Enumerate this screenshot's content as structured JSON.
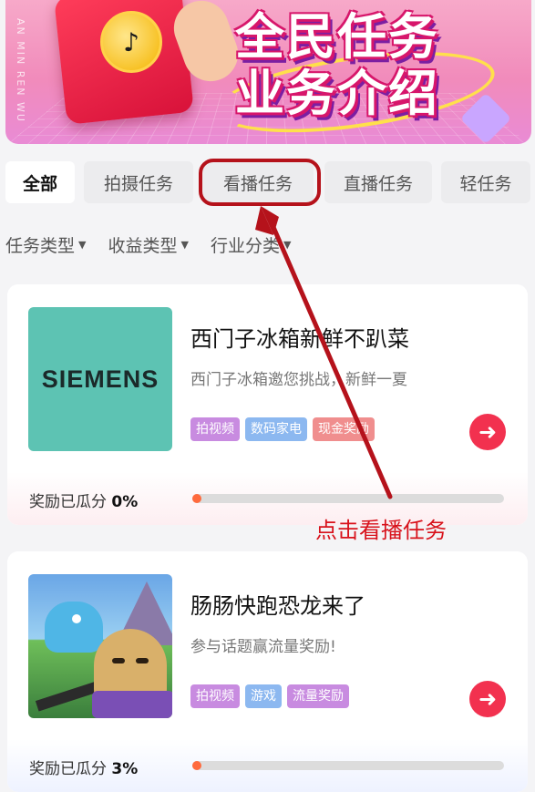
{
  "banner": {
    "title_line1": "全民任务",
    "title_line2": "业务介绍",
    "side_text": "AN MIN REN WU"
  },
  "tabs": [
    {
      "label": "全部",
      "active": true
    },
    {
      "label": "拍摄任务",
      "active": false
    },
    {
      "label": "看播任务",
      "active": false
    },
    {
      "label": "直播任务",
      "active": false
    },
    {
      "label": "轻任务",
      "active": false
    }
  ],
  "filters": [
    {
      "label": "任务类型"
    },
    {
      "label": "收益类型"
    },
    {
      "label": "行业分类"
    }
  ],
  "annotation": {
    "text": "点击看播任务",
    "color": "#d8121b"
  },
  "cards": [
    {
      "thumb_text": "SIEMENS",
      "title": "西门子冰箱新鲜不趴菜",
      "subtitle": "西门子冰箱邀您挑战，新鲜一夏",
      "tags": [
        "拍视频",
        "数码家电",
        "现金奖励"
      ],
      "progress_label": "奖励已瓜分",
      "progress_value": "0%",
      "progress_fraction": 0
    },
    {
      "title": "肠肠快跑恐龙来了",
      "subtitle": "参与话题赢流量奖励!",
      "tags": [
        "拍视频",
        "游戏",
        "流量奖励"
      ],
      "progress_label": "奖励已瓜分",
      "progress_value": "3%",
      "progress_fraction": 0.03
    }
  ],
  "icons": {
    "go_button": "arrow-right-icon",
    "filter_caret": "caret-down-icon"
  }
}
